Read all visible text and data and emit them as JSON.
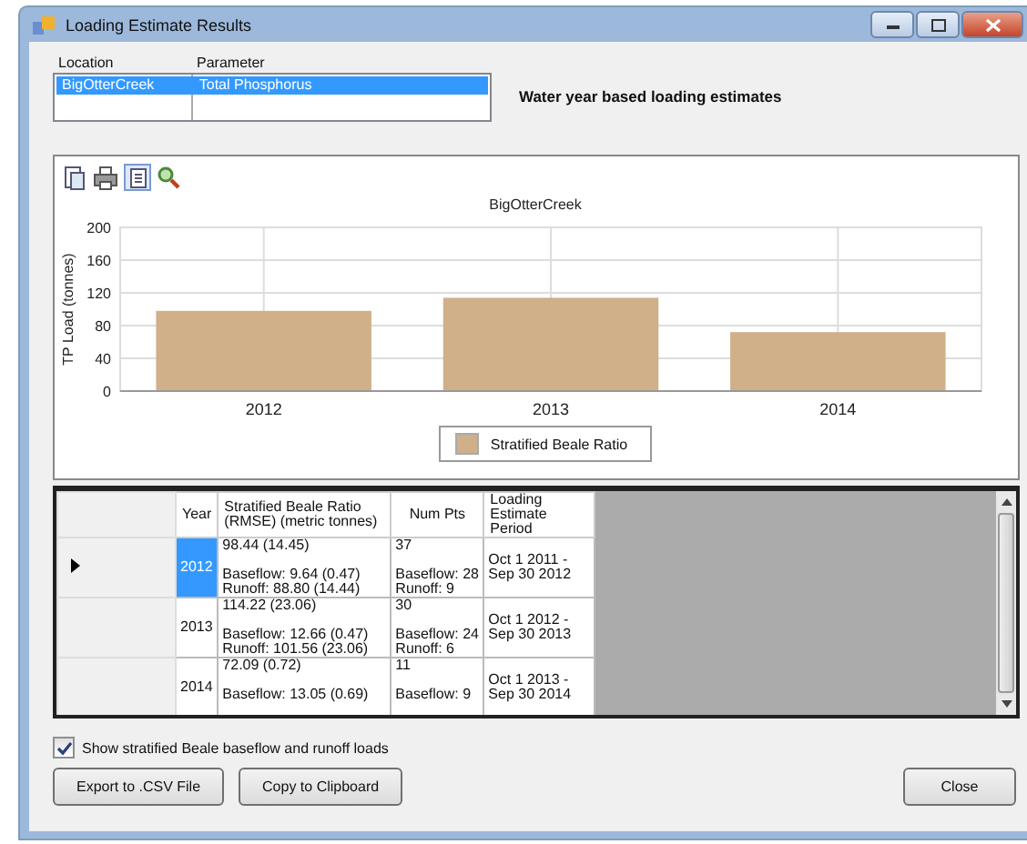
{
  "window": {
    "title": "Loading Estimate Results"
  },
  "selector": {
    "columns": [
      "Location",
      "Parameter"
    ],
    "rows": [
      {
        "location": "BigOtterCreek",
        "parameter": "Total Phosphorus",
        "selected": true
      }
    ]
  },
  "heading": "Water year based loading estimates",
  "chart": {
    "chart_data": {
      "type": "bar",
      "title": "BigOtterCreek",
      "ylabel": "TP Load (tonnes)",
      "categories": [
        "2012",
        "2013",
        "2014"
      ],
      "series": [
        {
          "name": "Stratified Beale Ratio",
          "color": "#cfb089",
          "values": [
            98,
            114,
            72
          ]
        }
      ],
      "ylim": [
        0,
        200
      ],
      "yticks": [
        0,
        40,
        80,
        120,
        160,
        200
      ],
      "grid": true
    }
  },
  "grid": {
    "columns": [
      "Year",
      "Stratified Beale Ratio\n(RMSE) (metric tonnes)",
      "Num Pts",
      "Loading\nEstimate Period"
    ],
    "rows": [
      {
        "current": true,
        "selected": true,
        "cells": [
          "2012",
          "98.44 (14.45)\n\nBaseflow:  9.64 (0.47)\nRunoff: 88.80 (14.44)",
          "37\n\nBaseflow: 28\nRunoff: 9",
          "Oct 1 2011 -\nSep 30 2012"
        ]
      },
      {
        "current": false,
        "selected": false,
        "cells": [
          "2013",
          "114.22 (23.06)\n\nBaseflow:  12.66 (0.47)\nRunoff: 101.56 (23.06)",
          "30\n\nBaseflow: 24\nRunoff: 6",
          "Oct 1 2012 -\nSep 30 2013"
        ]
      },
      {
        "current": false,
        "selected": false,
        "cells": [
          "2014",
          "72.09 (0.72)\n\nBaseflow:  13.05 (0.69)",
          "11\n\nBaseflow: 9",
          "Oct 1 2013 -\nSep 30 2014"
        ]
      }
    ]
  },
  "show_loads": {
    "label": "Show stratified Beale baseflow and runoff loads",
    "checked": true
  },
  "buttons": [
    {
      "label": "Export to .CSV File",
      "kind": "left"
    },
    {
      "label": "Copy to Clipboard",
      "kind": "left"
    },
    {
      "label": "Close",
      "kind": "right"
    }
  ]
}
